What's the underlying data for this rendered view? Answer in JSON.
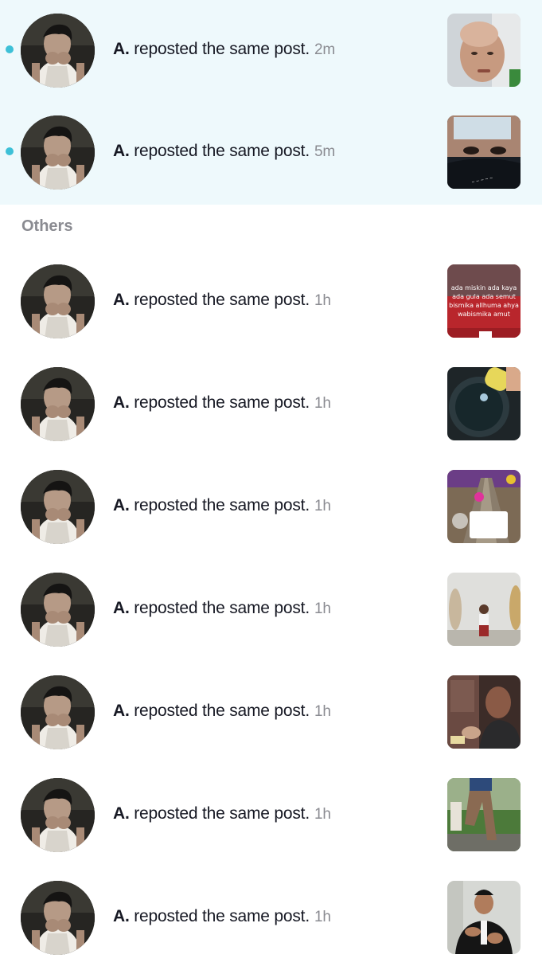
{
  "new_items": [
    {
      "name": "A.",
      "action": "reposted the same post.",
      "time": "2m",
      "unread": true,
      "thumb": "man-lying-bed"
    },
    {
      "name": "A.",
      "action": "reposted the same post.",
      "time": "5m",
      "unread": true,
      "thumb": "child-face-mask"
    }
  ],
  "others_label": "Others",
  "other_items": [
    {
      "name": "A.",
      "action": "reposted the same post.",
      "time": "1h",
      "thumb": "red-text-post",
      "thumb_text": [
        "ada miskin ada kaya",
        "ada gula ada semut",
        "bismika allhuma ahya",
        "wabismika amut"
      ]
    },
    {
      "name": "A.",
      "action": "reposted the same post.",
      "time": "1h",
      "thumb": "pan-oil"
    },
    {
      "name": "A.",
      "action": "reposted the same post.",
      "time": "1h",
      "thumb": "game-road"
    },
    {
      "name": "A.",
      "action": "reposted the same post.",
      "time": "1h",
      "thumb": "school-kid"
    },
    {
      "name": "A.",
      "action": "reposted the same post.",
      "time": "1h",
      "thumb": "man-eating"
    },
    {
      "name": "A.",
      "action": "reposted the same post.",
      "time": "1h",
      "thumb": "legs-outdoor"
    },
    {
      "name": "A.",
      "action": "reposted the same post.",
      "time": "1h",
      "thumb": "man-suit"
    }
  ],
  "colors": {
    "unread_bg": "#eef9fc",
    "unread_dot": "#3dc0d7",
    "text": "#161823",
    "muted": "#8a8b91"
  }
}
